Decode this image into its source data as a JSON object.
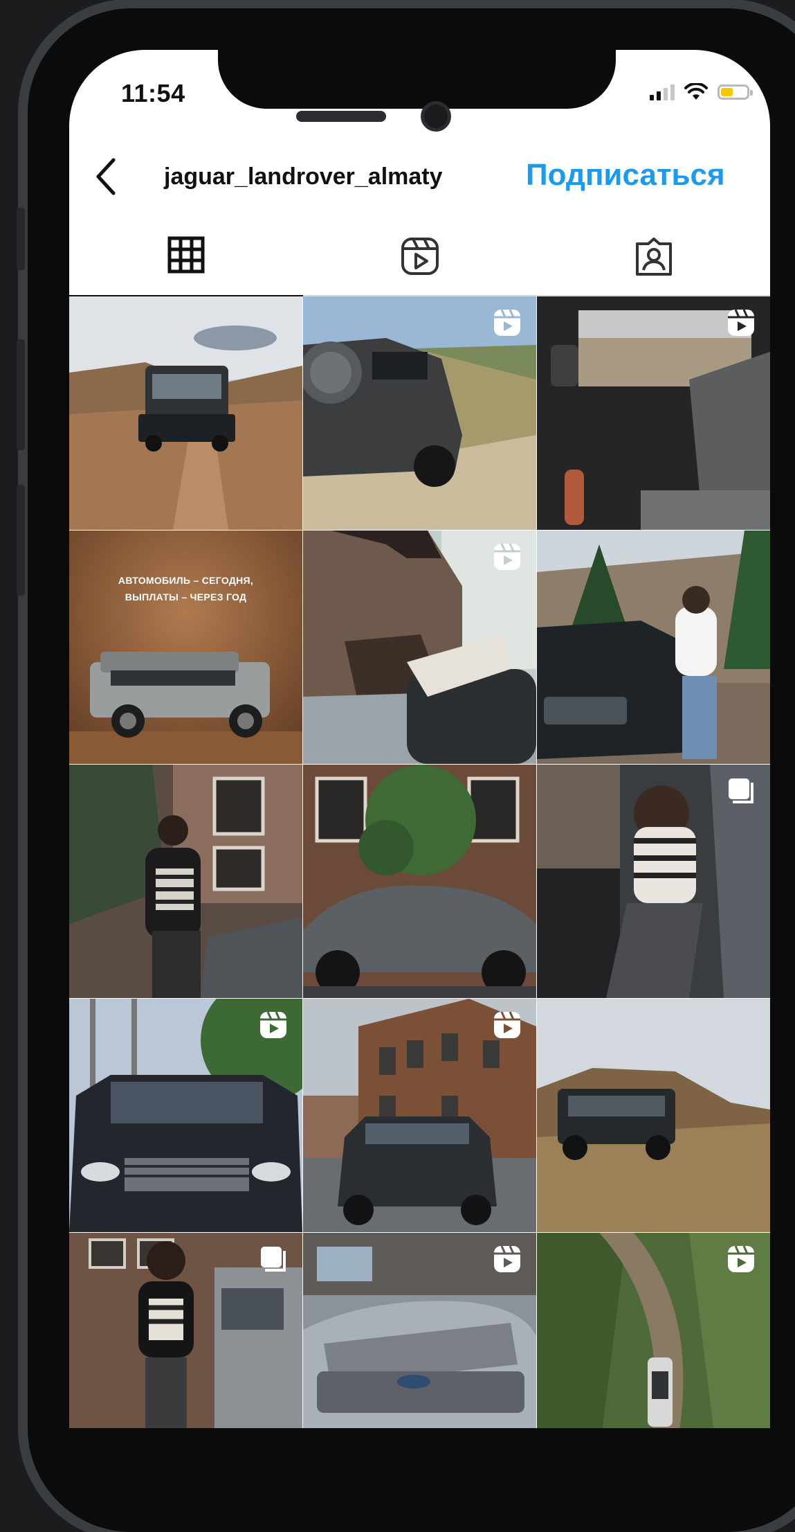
{
  "status_bar": {
    "time": "11:54",
    "signal_icon": "cellular-signal-icon",
    "wifi_icon": "wifi-icon",
    "battery_icon": "battery-icon",
    "battery_level": 0.45,
    "battery_color": "#f4c900"
  },
  "header": {
    "back_icon": "chevron-left-icon",
    "username": "jaguar_landrover_almaty",
    "follow_label": "Подписаться",
    "follow_color": "#1a9bf0"
  },
  "tabs": [
    {
      "icon": "grid-icon",
      "active": true
    },
    {
      "icon": "reels-icon",
      "active": false
    },
    {
      "icon": "tagged-icon",
      "active": false
    }
  ],
  "promo_post": {
    "headline_line1": "АВТОМОБИЛЬ – СЕГОДНЯ,",
    "headline_line2": "ВЫПЛАТЫ – ЧЕРЕЗ ГОД"
  },
  "posts": [
    {
      "subject": "Defender on dirt road",
      "badge": "none"
    },
    {
      "subject": "Defender rear on hillside",
      "badge": "reel-icon"
    },
    {
      "subject": "Car interior view",
      "badge": "reel-icon"
    },
    {
      "subject": "Promo Defender",
      "badge": "none"
    },
    {
      "subject": "Man driving",
      "badge": "reel-icon"
    },
    {
      "subject": "Woman with Jaguar",
      "badge": "none"
    },
    {
      "subject": "Woman by building",
      "badge": "none"
    },
    {
      "subject": "Range Rover Evoque at building",
      "badge": "none"
    },
    {
      "subject": "Woman in car door",
      "badge": "carousel-icon"
    },
    {
      "subject": "Range Rover front",
      "badge": "reel-icon"
    },
    {
      "subject": "Evoque by brick building",
      "badge": "reel-icon"
    },
    {
      "subject": "Defender on hill",
      "badge": "none"
    },
    {
      "subject": "Woman with car",
      "badge": "carousel-icon"
    },
    {
      "subject": "Velar silver",
      "badge": "reel-icon"
    },
    {
      "subject": "Aerial Defender on trail",
      "badge": "reel-icon"
    }
  ]
}
